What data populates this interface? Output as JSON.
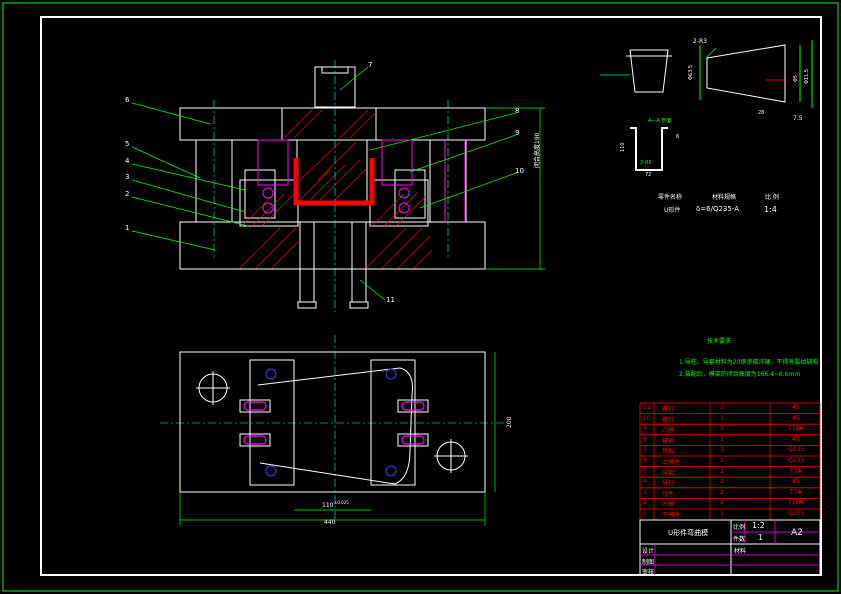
{
  "drawing": {
    "part_labels": [
      "1",
      "2",
      "3",
      "4",
      "5",
      "6",
      "7",
      "8",
      "9",
      "10",
      "11"
    ],
    "dimensions": {
      "height_right": "闭合高度190",
      "width_bottom": "440",
      "width_mid": "110",
      "width_mid_tol": "±0.025",
      "depth_right": "200"
    },
    "part_view": {
      "radius_label": "2-R3",
      "dim_left": "Φ63.5",
      "dim_right1": "Φ5",
      "dim_right2": "Φ11.5",
      "dim_bottom1": "7.5",
      "dim_bottom2": "28",
      "section_label": "A—A 剖面",
      "section_dim1": "110",
      "section_dim2": "72",
      "section_dim3": "6",
      "section_r": "2-R6"
    },
    "part_table": {
      "h1": "零件名称",
      "h2": "材料规格",
      "h3": "比 例",
      "v1": "U形件",
      "v2": "δ=6/Q235-A",
      "v3": "1:4"
    },
    "tech_req": {
      "title": "技术要求",
      "line1": "1.导柱、导套材料为20钢渗碳淬硬，不得有裂纹缺陷",
      "line2": "2.装配后，模架的闭合高度为166.4~6.6mm"
    }
  },
  "bom": [
    {
      "no": "11",
      "name": "螺钉",
      "qty": "2",
      "mat": "45"
    },
    {
      "no": "10",
      "name": "螺钉",
      "qty": "1",
      "mat": "45"
    },
    {
      "no": "9",
      "name": "凸模",
      "qty": "1",
      "mat": "T10A"
    },
    {
      "no": "8",
      "name": "模柄",
      "qty": "1",
      "mat": "45"
    },
    {
      "no": "7",
      "name": "垫板",
      "qty": "1",
      "mat": "Q235"
    },
    {
      "no": "6",
      "name": "上模座",
      "qty": "1",
      "mat": "Q235"
    },
    {
      "no": "5",
      "name": "导套",
      "qty": "2",
      "mat": "T7A"
    },
    {
      "no": "4",
      "name": "导柱",
      "qty": "2",
      "mat": "45"
    },
    {
      "no": "3",
      "name": "顶件",
      "qty": "2",
      "mat": "T7A"
    },
    {
      "no": "2",
      "name": "凹模",
      "qty": "2",
      "mat": "T10A"
    },
    {
      "no": "1",
      "name": "下模座",
      "qty": "1",
      "mat": "Q235"
    }
  ],
  "title_block": {
    "title": "U形件弯曲模",
    "scale_label": "比例",
    "scale_value": "1:2",
    "sheet_label": "件数",
    "sheet_value": "1",
    "size": "A2",
    "material_label": "材料",
    "row1": "设计",
    "row2": "制图",
    "row3": "审核"
  },
  "colors": {
    "frame": "#ffffff",
    "border": "#00ff00",
    "outline": "#ffffff",
    "leader": "#00ff00",
    "hatch": "#ff0000",
    "part": "#ff0000",
    "magenta": "#ff00ff",
    "cyan": "#00ffff",
    "text_green": "#00ff00",
    "yellow": "#ffff00",
    "bom_red": "#ff0000",
    "blue": "#4040ff"
  }
}
